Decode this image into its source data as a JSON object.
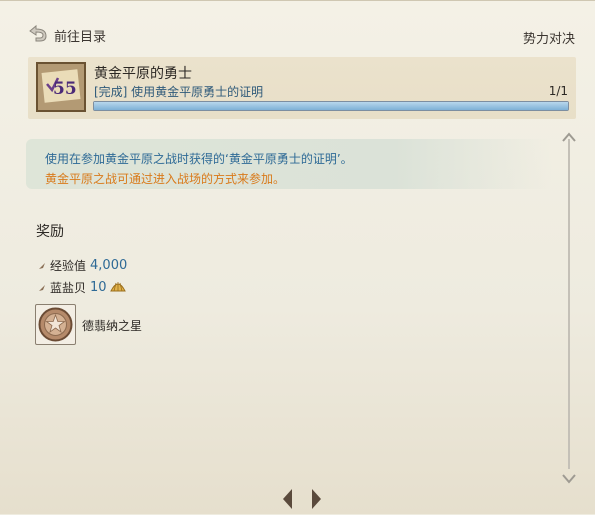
{
  "header": {
    "back_label": "前往目录",
    "faction_label": "势力对决"
  },
  "quest": {
    "title": "黄金平原的勇士",
    "icon_number": "55",
    "status": "[完成] 使用黄金平原勇士的证明",
    "count": "1/1",
    "progress": 1.0
  },
  "description": {
    "line1": "使用在参加黄金平原之战时获得的‘黄金平原勇士的证明’。",
    "line2": "黄金平原之战可通过进入战场的方式来参加。"
  },
  "rewards": {
    "heading": "奖励",
    "items": [
      {
        "label": "经验值",
        "value": "4,000"
      },
      {
        "label": "蓝盐贝",
        "value": "10",
        "icon": "shell-icon"
      }
    ],
    "item_name": "德翡纳之星",
    "item_icon": "star-medal-icon"
  },
  "colors": {
    "accent_blue": "#2e6a96",
    "accent_orange": "#d97a1a",
    "progress_fill": "#7eb1d6"
  }
}
